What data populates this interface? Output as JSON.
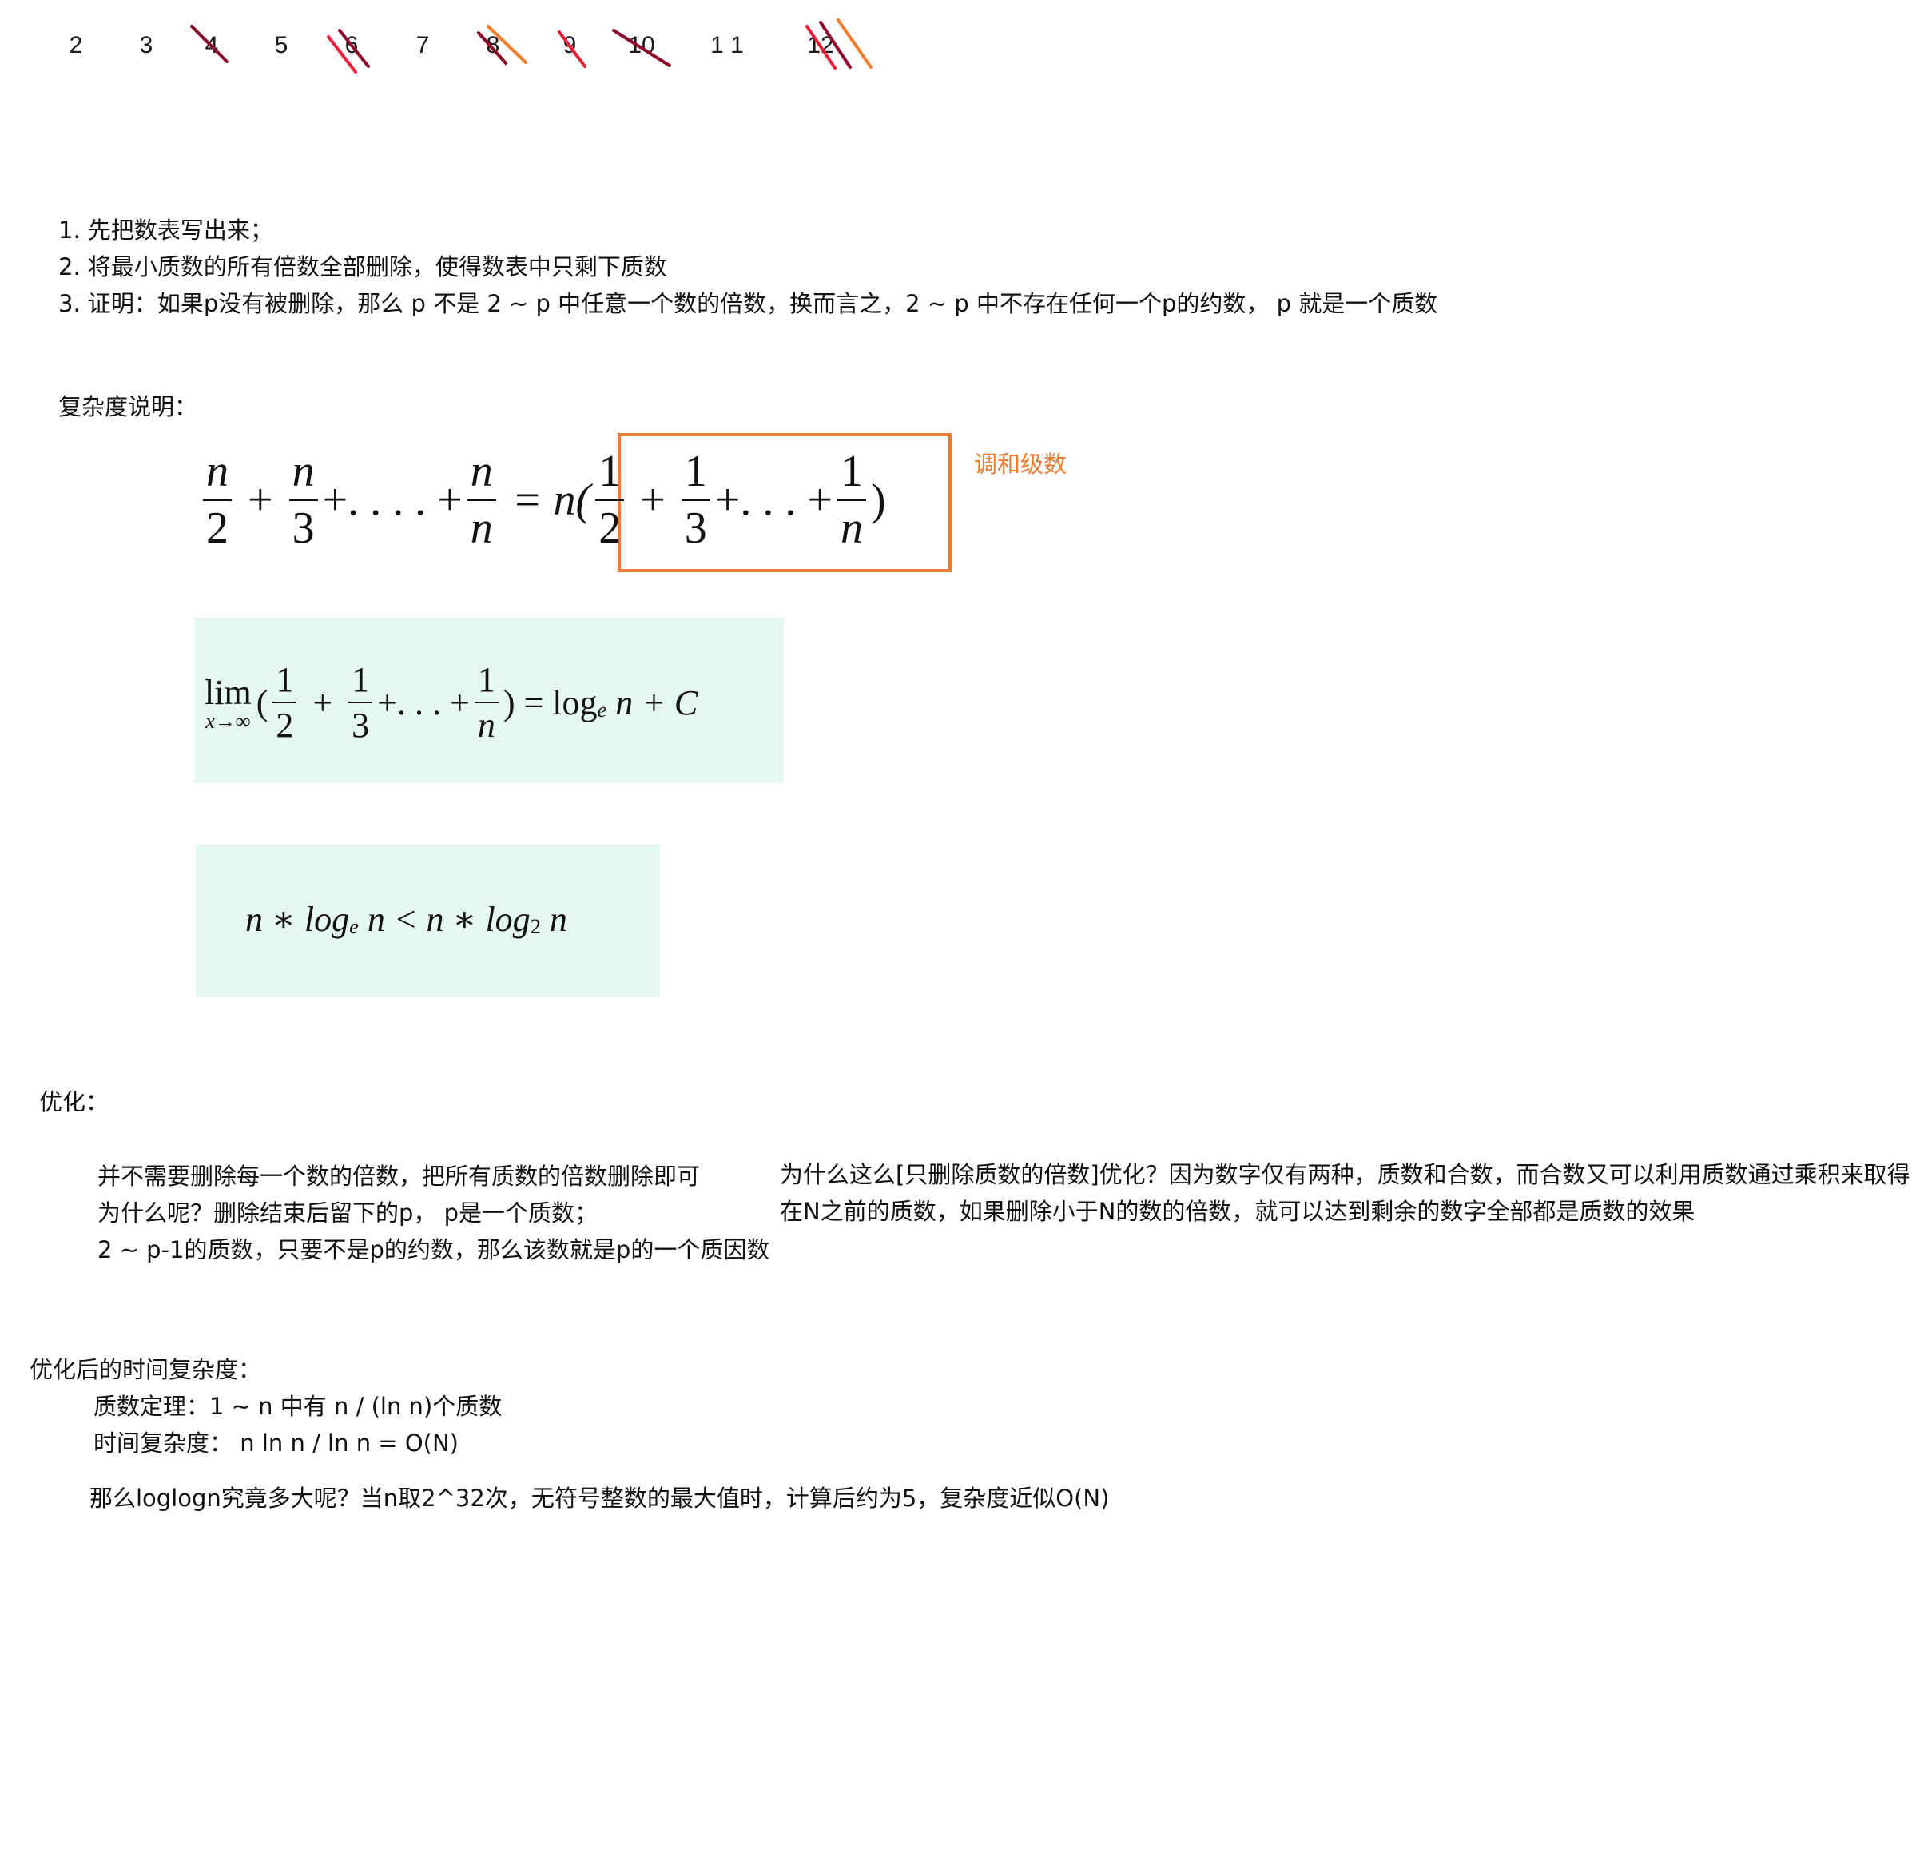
{
  "sieve": {
    "numbers": [
      "2",
      "3",
      "4",
      "5",
      "6",
      "7",
      "8",
      "9",
      "10",
      "1 1",
      "12"
    ],
    "strike_colors": {
      "dark": "#8b0a2a",
      "red": "#e8203a",
      "orange": "#f07d2b"
    }
  },
  "steps": [
    "1. 先把数表写出来；",
    "2. 将最小质数的所有倍数全部删除，使得数表中只剩下质数",
    "3. 证明：如果p没有被删除，那么 p 不是 2 ~ p 中任意一个数的倍数，换而言之，2 ~ p 中不存在任何一个p的约数， p 就是一个质数"
  ],
  "complexity": {
    "heading": "复杂度说明：",
    "harmonic_label": "调和级数",
    "accent_color": "#ed7d31",
    "box_color": "#e6f7ef",
    "eq1": {
      "t1_num": "n",
      "t1_den": "2",
      "plus": "+",
      "t2_num": "n",
      "t2_den": "3",
      "dots1": "+. . . . +",
      "t3_num": "n",
      "t3_den": "n",
      "eq": "= n(",
      "h1_num": "1",
      "h1_den": "2",
      "h2_num": "1",
      "h2_den": "3",
      "dots2": "+. . . +",
      "h3_num": "1",
      "h3_den": "n",
      "close": ")"
    },
    "eq2": {
      "lim": "lim",
      "lim_sub": "x→∞",
      "open": "(",
      "a_num": "1",
      "a_den": "2",
      "plus": "+",
      "b_num": "1",
      "b_den": "3",
      "dots": "+. . . +",
      "c_num": "1",
      "c_den": "n",
      "rhs_pre": ") = log",
      "rhs_sub": "e",
      "rhs_post": " n + C"
    },
    "eq3": {
      "p1": "n ∗ log",
      "s1": "e",
      "p2": " n < n ∗ log",
      "s2": "2",
      "p3": " n"
    }
  },
  "optimize": {
    "heading": "优化：",
    "left_lines": [
      "并不需要删除每一个数的倍数，把所有质数的倍数删除即可",
      "为什么呢？删除结束后留下的p， p是一个质数；",
      "2 ~ p-1的质数，只要不是p的约数，那么该数就是p的一个质因数"
    ],
    "right_lines": [
      "为什么这么[只删除质数的倍数]优化？因为数字仅有两种，质数和合数，而合数又可以利用质数通过乘积来取得，",
      "在N之前的质数，如果删除小于N的数的倍数，就可以达到剩余的数字全部都是质数的效果"
    ]
  },
  "after": {
    "heading": "优化后的时间复杂度：",
    "line1": "质数定理：1 ~ n 中有  n / (ln n)个质数",
    "line2": "时间复杂度：  n ln n / ln n = O(N)",
    "line3": "那么loglogn究竟多大呢？当n取2^32次，无符号整数的最大值时，计算后约为5，复杂度近似O(N)"
  }
}
